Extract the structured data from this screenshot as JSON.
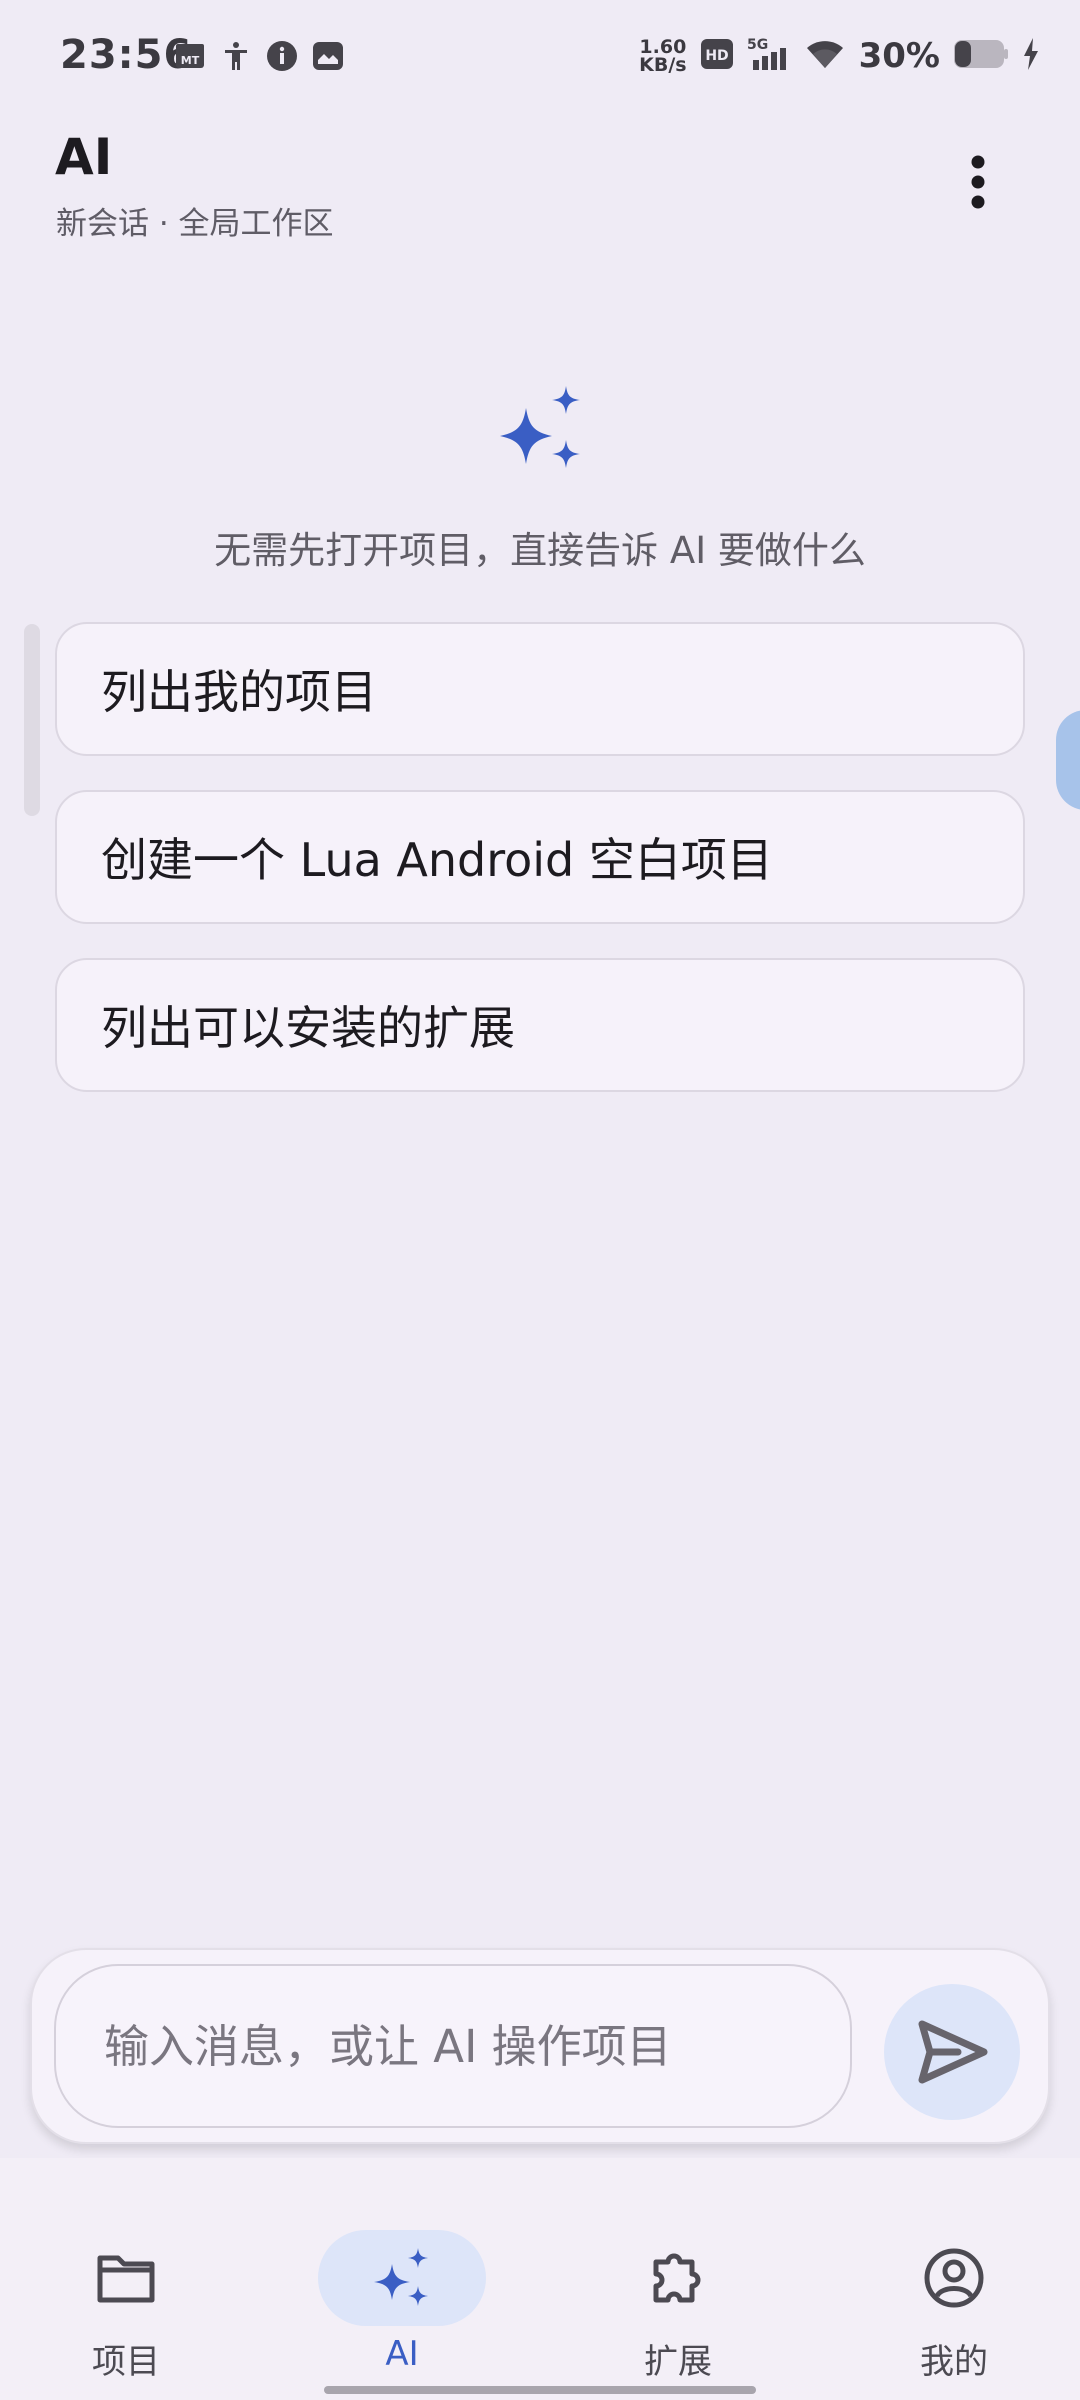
{
  "status_bar": {
    "time": "23:56",
    "net_speed_value": "1.60",
    "net_speed_unit": "KB/s",
    "hd_badge": "HD",
    "network": "5G",
    "battery_percent": "30%",
    "icons": [
      "mt-icon",
      "accessibility-icon",
      "info-icon",
      "gallery-icon",
      "signal-icon",
      "wifi-icon",
      "battery-icon",
      "charging-icon"
    ]
  },
  "header": {
    "title": "AI",
    "subtitle": "新会话 · 全局工作区",
    "menu_icon": "more-vert-icon"
  },
  "empty_state": {
    "icon": "sparkle-icon",
    "hint": "无需先打开项目，直接告诉 AI 要做什么"
  },
  "suggestions": [
    {
      "label": "列出我的项目"
    },
    {
      "label": "创建一个 Lua Android 空白项目"
    },
    {
      "label": "列出可以安装的扩展"
    }
  ],
  "composer": {
    "placeholder": "输入消息，或让 AI 操作项目",
    "value": "",
    "send_icon": "send-icon"
  },
  "bottom_nav": {
    "items": [
      {
        "label": "项目",
        "icon": "folder-icon",
        "active": false
      },
      {
        "label": "AI",
        "icon": "sparkle-icon",
        "active": true
      },
      {
        "label": "扩展",
        "icon": "puzzle-icon",
        "active": false
      },
      {
        "label": "我的",
        "icon": "account-icon",
        "active": false
      }
    ]
  },
  "colors": {
    "background": "#efebf5",
    "accent": "#3a5ec4",
    "accent_container": "#dde5f9",
    "card": "#f6f2fa"
  }
}
